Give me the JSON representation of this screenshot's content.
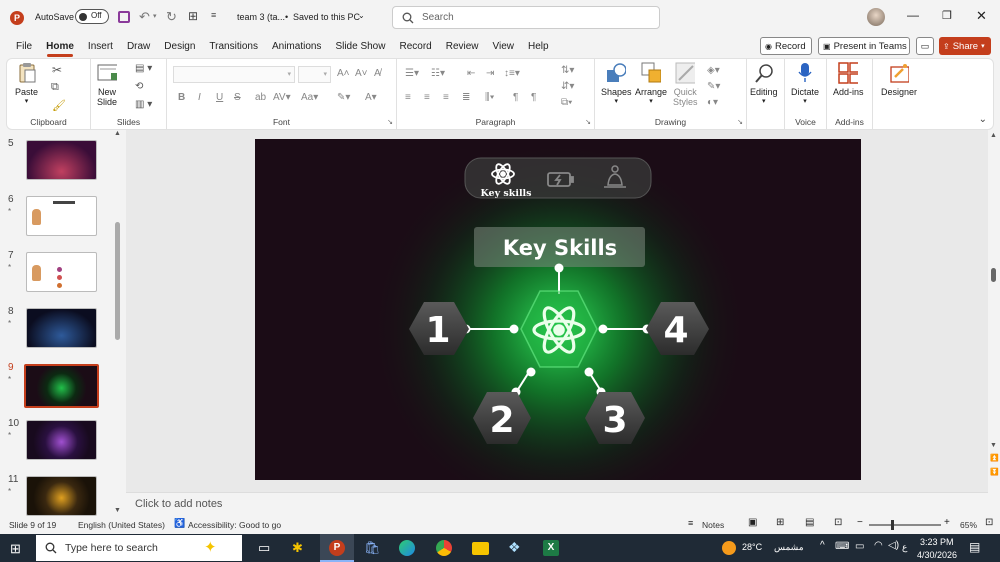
{
  "titlebar": {
    "autosave_label": "AutoSave",
    "autosave_state": "Off",
    "doc_title": "team 3 (ta...",
    "saved_status": "Saved to this PC",
    "search_placeholder": "Search"
  },
  "tabs": [
    "File",
    "Home",
    "Insert",
    "Draw",
    "Design",
    "Transitions",
    "Animations",
    "Slide Show",
    "Record",
    "Review",
    "View",
    "Help"
  ],
  "right_buttons": {
    "record": "Record",
    "teams": "Present in Teams",
    "share": "Share"
  },
  "ribbon": {
    "clipboard": {
      "paste": "Paste",
      "label": "Clipboard"
    },
    "slides": {
      "new_slide_1": "New",
      "new_slide_2": "Slide",
      "label": "Slides"
    },
    "font": {
      "label": "Font"
    },
    "paragraph": {
      "label": "Paragraph"
    },
    "drawing": {
      "shapes": "Shapes",
      "arrange": "Arrange",
      "quick_1": "Quick",
      "quick_2": "Styles",
      "label": "Drawing"
    },
    "editing": {
      "label": "Editing"
    },
    "voice": {
      "dictate": "Dictate",
      "label": "Voice"
    },
    "addins": {
      "button": "Add-ins",
      "label": "Add-ins"
    },
    "designer": {
      "button": "Designer"
    }
  },
  "thumbnails": [
    {
      "num": "5",
      "star": ""
    },
    {
      "num": "6",
      "star": "*"
    },
    {
      "num": "7",
      "star": "*"
    },
    {
      "num": "8",
      "star": "*"
    },
    {
      "num": "9",
      "star": "*"
    },
    {
      "num": "10",
      "star": "*"
    },
    {
      "num": "11",
      "star": "*"
    }
  ],
  "slide": {
    "top_nav_label": "Key skills",
    "title": "Key Skills",
    "numbers": [
      "1",
      "2",
      "3",
      "4"
    ]
  },
  "notes_placeholder": "Click to add notes",
  "status": {
    "slide_info": "Slide 9 of 19",
    "language": "English (United States)",
    "accessibility": "Accessibility: Good to go",
    "notes": "Notes",
    "zoom": "65%"
  },
  "taskbar": {
    "search_placeholder": "Type here to search",
    "temperature": "28°C",
    "weather": "مشمس",
    "lang": "ع",
    "time": "3:23 PM",
    "date": "4/30/2026"
  },
  "colors": {
    "accent": "#c43e1c",
    "glow": "#1fd14d",
    "slide_bg": "#1b0c16"
  }
}
